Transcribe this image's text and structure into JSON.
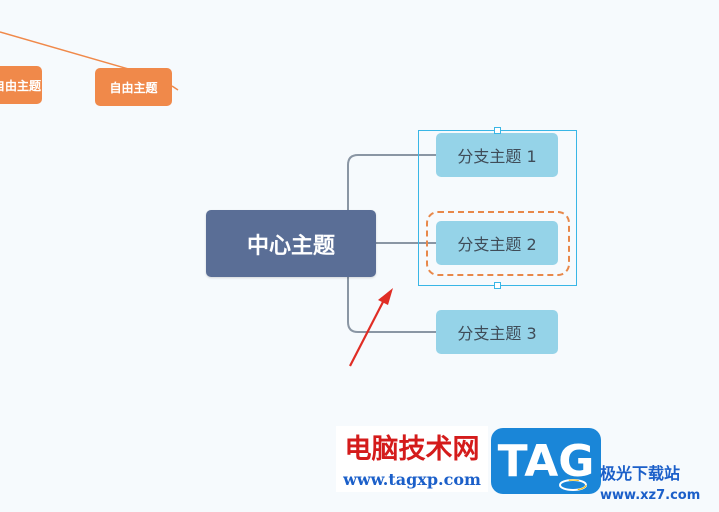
{
  "mindmap": {
    "free_topics": [
      {
        "label": "自由主题"
      },
      {
        "label": "自由主题"
      }
    ],
    "central_topic": {
      "label": "中心主题"
    },
    "branches": [
      {
        "label": "分支主题 1"
      },
      {
        "label": "分支主题 2"
      },
      {
        "label": "分支主题 3"
      }
    ]
  },
  "watermark": {
    "site_cn": "电脑技术网",
    "site_url": "www.tagxp.com",
    "logo_text": "TAG",
    "partner_name": "极光下载站",
    "partner_url": "www.xz7.com"
  },
  "colors": {
    "background": "#f6fafd",
    "central_fill": "#5a6e96",
    "branch_fill": "#95d3e8",
    "free_topic_fill": "#f0894a",
    "selection": "#39b6e6",
    "dashed_highlight": "#e8884a",
    "arrow": "#e02d25",
    "connector": "#8a96a4"
  },
  "icons": {
    "pointer_arrow": "red-arrow-icon"
  }
}
